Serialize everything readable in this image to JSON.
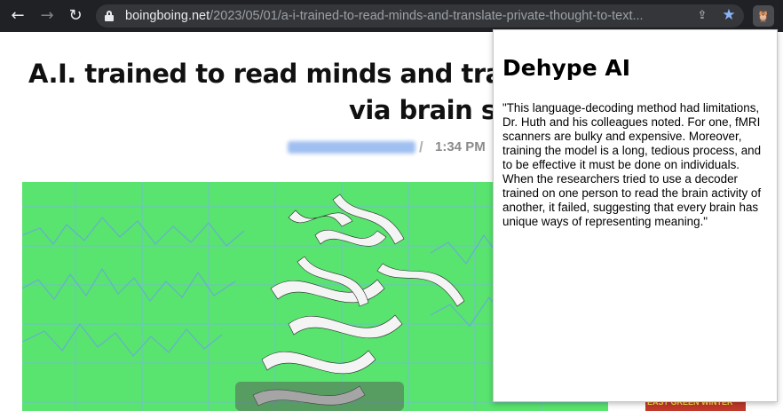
{
  "browser": {
    "url_host": "boingboing.net",
    "url_path": "/2023/05/01/a-i-trained-to-read-minds-and-translate-private-thought-to-text...",
    "back_glyph": "←",
    "forward_glyph": "→",
    "reload_glyph": "↻",
    "share_glyph": "⇪",
    "star_glyph": "★",
    "extension_glyph": "🦉"
  },
  "article": {
    "headline_line1": "A.I. trained to read minds and trans",
    "headline_line2": "via brain sc",
    "byline_separator": "/",
    "time": "1:34 PM"
  },
  "sidebar_ad": {
    "label": "EAST GREEN WINTER"
  },
  "popup": {
    "title": "Dehype AI",
    "quote": "\"This language-decoding method had limitations, Dr. Huth and his colleagues noted. For one, fMRI scanners are bulky and expensive. Moreover, training the model is a long, tedious process, and to be effective it must be done on individuals. When the researchers tried to use a decoder trained on one person to read the brain activity of another, it failed, suggesting that every brain has unique ways of representing meaning.\""
  },
  "colors": {
    "toolbar_bg": "#202124",
    "hero_green": "#58e46f",
    "star_blue": "#8ab4f8"
  }
}
